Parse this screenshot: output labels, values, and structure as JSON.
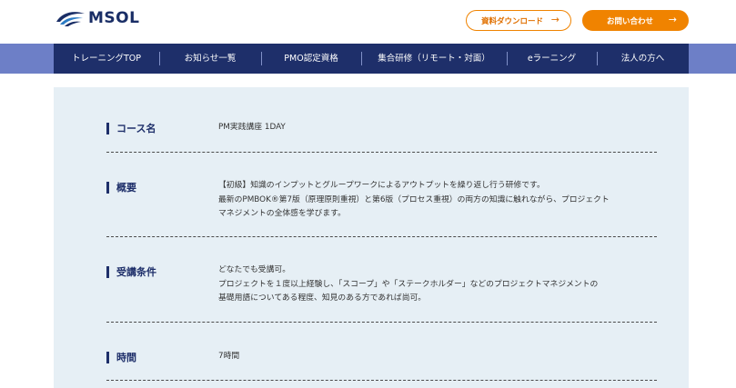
{
  "header": {
    "logo_text": "MSOL",
    "download_button": "資料ダウンロード",
    "contact_button": "お問い合わせ",
    "arrow_icon": "→"
  },
  "nav": {
    "items": [
      {
        "label": "トレーニングTOP"
      },
      {
        "label": "お知らせ一覧"
      },
      {
        "label": "PMO認定資格"
      },
      {
        "label": "集合研修（リモート・対面）"
      },
      {
        "label": "eラーニング"
      },
      {
        "label": "法人の方へ"
      }
    ]
  },
  "course": {
    "rows": [
      {
        "label": "コース名",
        "lines": [
          "PM実践講座 1DAY"
        ]
      },
      {
        "label": "概要",
        "lines": [
          "【初級】知識のインプットとグループワークによるアウトプットを繰り返し行う研修です。",
          "最新のPMBOK®第7版（原理原則重視）と第6版（プロセス重視）の両方の知識に触れながら、プロジェクト",
          "マネジメントの全体感を学びます。"
        ]
      },
      {
        "label": "受講条件",
        "lines": [
          "どなたでも受講可。",
          "プロジェクトを１度以上経験し、「スコープ」や「ステークホルダー」などのプロジェクトマネジメントの",
          "基礎用語についてある程度、知見のある方であれば尚可。"
        ]
      },
      {
        "label": "時間",
        "lines": [
          "7時間"
        ]
      }
    ]
  },
  "colors": {
    "navy": "#1e2f6a",
    "nav_band": "#6d7fc7",
    "orange": "#f08300",
    "panel_bg": "#e6eff5"
  }
}
